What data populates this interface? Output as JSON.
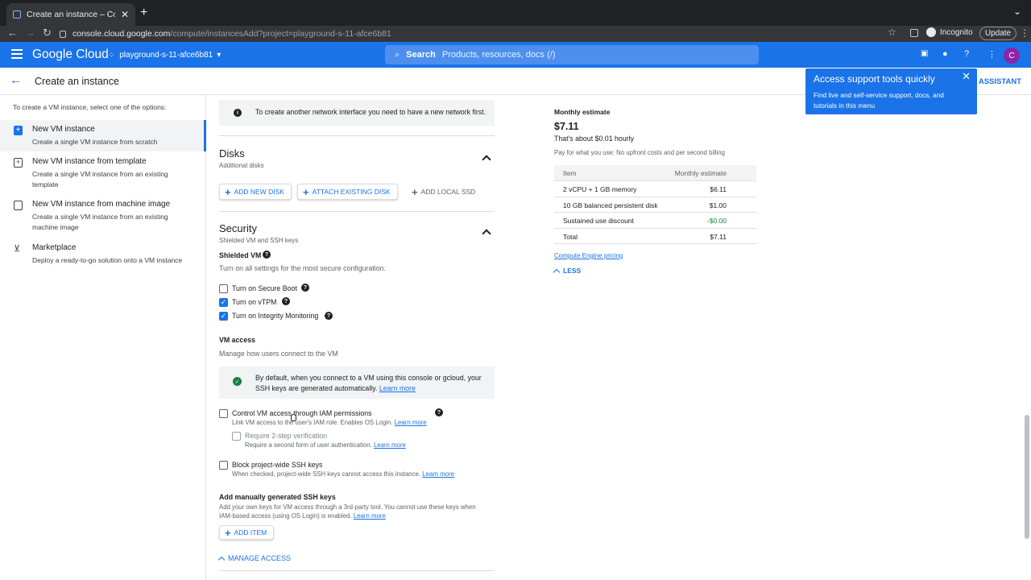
{
  "browser": {
    "tab_title": "Create an instance – Compute",
    "url_host": "console.cloud.google.com",
    "url_path": "/compute/instancesAdd?project=playground-s-11-afce6b81",
    "incognito_label": "Incognito",
    "update_label": "Update"
  },
  "header": {
    "logo": "Google Cloud",
    "project": "playground-s-11-afce6b81",
    "search_label": "Search",
    "search_placeholder": "Products, resources, docs (/)",
    "avatar_letter": "C"
  },
  "page": {
    "title": "Create an instance",
    "assistant": "ASSISTANT"
  },
  "popup": {
    "title": "Access support tools quickly",
    "body": "Find live and self-service support, docs, and tutorials in this menu"
  },
  "left": {
    "intro": "To create a VM instance, select one of the options:",
    "options": [
      {
        "title": "New VM instance",
        "desc": "Create a single VM instance from scratch"
      },
      {
        "title": "New VM instance from template",
        "desc": "Create a single VM instance from an existing template"
      },
      {
        "title": "New VM instance from machine image",
        "desc": "Create a single VM instance from an existing machine image"
      },
      {
        "title": "Marketplace",
        "desc": "Deploy a ready-to-go solution onto a VM instance"
      }
    ]
  },
  "form": {
    "network_info": "To create another network interface you need to have a new network first.",
    "disks": {
      "title": "Disks",
      "subtitle": "Additional disks",
      "add_new": "ADD NEW DISK",
      "attach": "ATTACH EXISTING DISK",
      "local_ssd": "ADD LOCAL SSD"
    },
    "security": {
      "title": "Security",
      "subtitle": "Shielded VM and SSH keys",
      "shielded_label": "Shielded VM",
      "shielded_desc": "Turn on all settings for the most secure configuration.",
      "secure_boot": "Turn on Secure Boot",
      "vtpm": "Turn on vTPM",
      "integrity": "Turn on Integrity Monitoring",
      "vm_access_label": "VM access",
      "vm_access_desc": "Manage how users connect to the VM",
      "ssh_info": "By default, when you connect to a VM using this console or gcloud, your SSH keys are generated automatically.",
      "learn_more": "Learn more",
      "iam_label": "Control VM access through IAM permissions",
      "iam_desc": "Link VM access to the user's IAM role. Enables OS Login.",
      "twostep_label": "Require 2-step verification",
      "twostep_desc": "Require a second form of user authentication.",
      "block_label": "Block project-wide SSH keys",
      "block_desc": "When checked, project-wide SSH keys cannot access this instance.",
      "manual_label": "Add manually generated SSH keys",
      "manual_desc": "Add your own keys for VM access through a 3rd-party tool. You cannot use these keys when IAM-based access (using OS Login) is enabled.",
      "add_item": "ADD ITEM",
      "manage_access": "MANAGE ACCESS"
    }
  },
  "estimate": {
    "heading": "Monthly estimate",
    "price": "$7.11",
    "hourly": "That's about $0.01 hourly",
    "payg": "Pay for what you use: No upfront costs and per second billing",
    "col_item": "Item",
    "col_est": "Monthly estimate",
    "rows": [
      {
        "item": "2 vCPU + 1 GB memory",
        "cost": "$6.11"
      },
      {
        "item": "10 GB balanced persistent disk",
        "cost": "$1.00"
      },
      {
        "item": "Sustained use discount",
        "cost": "-$0.00"
      },
      {
        "item": "Total",
        "cost": "$7.11"
      }
    ],
    "pricing_link": "Compute Engine pricing",
    "less": "LESS"
  },
  "colors": {
    "brand": "#1a73e8",
    "discount": "#188038"
  }
}
